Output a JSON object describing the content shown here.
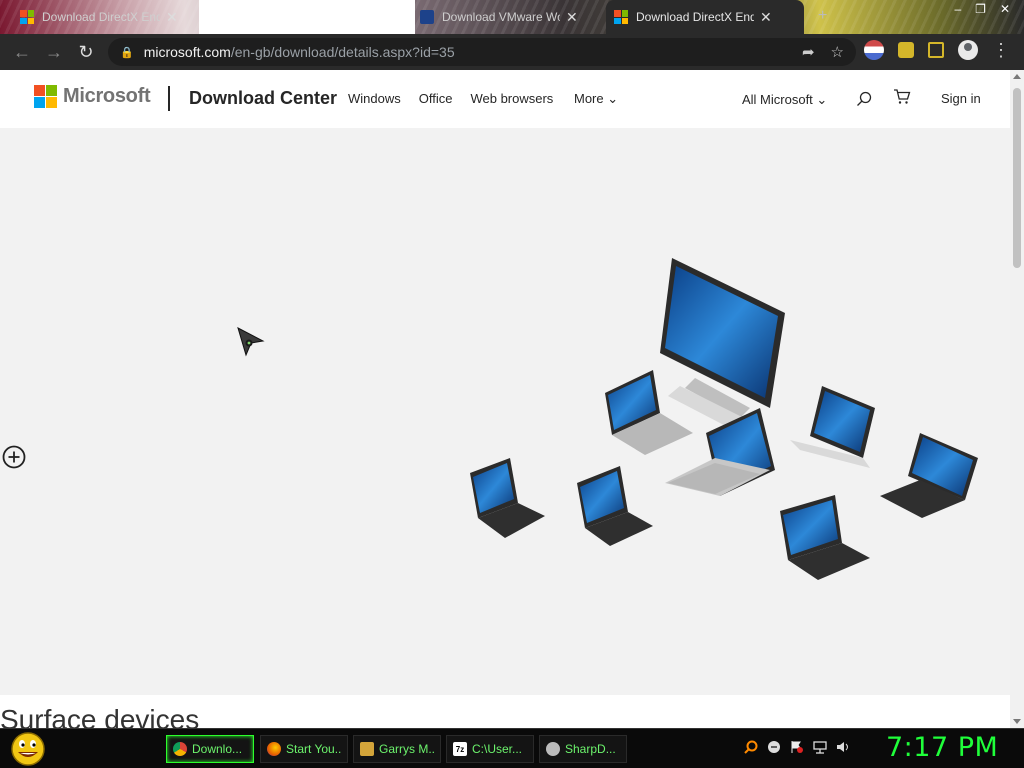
{
  "browser": {
    "tabs": [
      {
        "title": "Download DirectX End-U",
        "favicon": "microsoft-logo"
      },
      {
        "title": "Download VMware Wo",
        "favicon": "vmware-logo"
      },
      {
        "title": "Download DirectX End-U",
        "favicon": "microsoft-logo",
        "active": true
      }
    ],
    "new_tab": "+",
    "window_controls": [
      "–",
      "❐",
      "✕"
    ],
    "url": {
      "host": "microsoft.com",
      "path": "/en-gb/download/details.aspx?id=35"
    },
    "extensions": [
      "flag-extension",
      "puzzle-extension",
      "side-panel",
      "profile-avatar"
    ]
  },
  "site": {
    "brand": "Microsoft",
    "section": "Download Center",
    "nav": [
      "Windows",
      "Office",
      "Web browsers"
    ],
    "more": "More",
    "all_microsoft": "All Microsoft",
    "sign_in": "Sign in",
    "hero_title": "Surface devices"
  },
  "taskbar": {
    "tasks": [
      {
        "label": "Downlo...",
        "icon": "chrome-icon",
        "color": "#4285f4",
        "active": true
      },
      {
        "label": "Start You...",
        "icon": "firefox-icon",
        "color": "#e66000"
      },
      {
        "label": "Garrys M...",
        "icon": "gmod-icon",
        "color": "#d4a53a"
      },
      {
        "label": "C:\\User...",
        "icon": "7zip-icon",
        "color": "#cccccc"
      },
      {
        "label": "SharpD...",
        "icon": "sharpdevelop-icon",
        "color": "#bbbbbb"
      }
    ],
    "clock": "7:17 PM"
  },
  "colors": {
    "accent": "#2cff2c",
    "ms_red": "#f25022",
    "ms_green": "#7fba00",
    "ms_blue": "#00a4ef",
    "ms_yellow": "#ffb900"
  }
}
